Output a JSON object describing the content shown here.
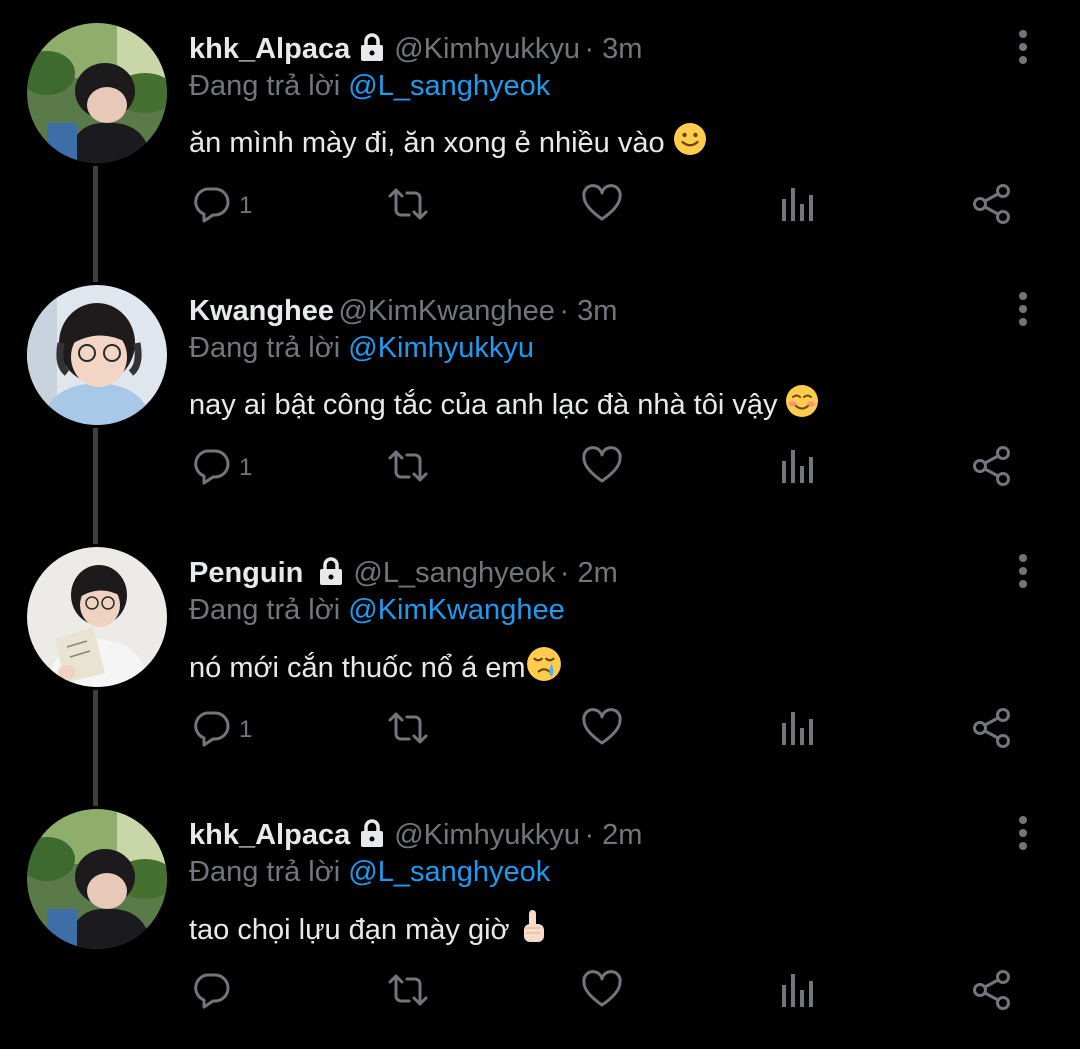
{
  "colors": {
    "background": "#000000",
    "text": "#e7e9ea",
    "muted": "#71767b",
    "mention": "#1d9bf0",
    "thread_line": "#3d4043"
  },
  "reply_prefix": "Đang trả lời",
  "tweets": [
    {
      "name": "khk_Alpaca",
      "locked": true,
      "handle": "@Kimhyukkyu",
      "time": "· 3m",
      "reply_to": "@L_sanghyeok",
      "text": "ăn mình mày đi, ăn xong ẻ nhiều vào",
      "emoji": "slightly-smiling-face",
      "reply_count": "1",
      "icons": [
        "reply-icon",
        "retweet-icon",
        "like-icon",
        "analytics-icon",
        "share-icon",
        "more-icon"
      ]
    },
    {
      "name": "Kwanghee",
      "locked": false,
      "handle": "@KimKwanghee",
      "time": "· 3m",
      "reply_to": "@Kimhyukkyu",
      "text": "nay ai bật công tắc của anh lạc đà nhà tôi vậy",
      "emoji": "smiling-face",
      "reply_count": "1",
      "icons": [
        "reply-icon",
        "retweet-icon",
        "like-icon",
        "analytics-icon",
        "share-icon",
        "more-icon"
      ]
    },
    {
      "name": "Penguin",
      "locked": true,
      "handle": "@L_sanghyeok",
      "time": "· 2m",
      "reply_to": "@KimKwanghee",
      "text": "nó mới cắn thuốc nổ á em",
      "emoji": "crying-face",
      "reply_count": "1",
      "icons": [
        "reply-icon",
        "retweet-icon",
        "like-icon",
        "analytics-icon",
        "share-icon",
        "more-icon"
      ]
    },
    {
      "name": "khk_Alpaca",
      "locked": true,
      "handle": "@Kimhyukkyu",
      "time": "· 2m",
      "reply_to": "@L_sanghyeok",
      "text": "tao chọi lựu đạn mày giờ",
      "emoji": "index-pointing-up",
      "reply_count": "",
      "icons": [
        "reply-icon",
        "retweet-icon",
        "like-icon",
        "analytics-icon",
        "share-icon",
        "more-icon"
      ]
    }
  ]
}
